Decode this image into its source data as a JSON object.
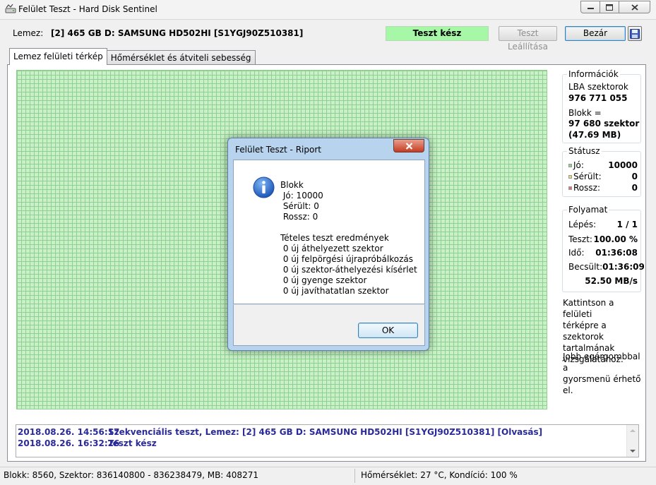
{
  "window": {
    "title": "Felület Teszt - Hard Disk Sentinel"
  },
  "toprow": {
    "disk_label": "Lemez:",
    "disk_value": "[2] 465 GB D: SAMSUNG HD502HI [S1YGJ90Z510381]",
    "status": "Teszt kész",
    "stop_button": "Teszt Leállítása",
    "close_button": "Bezár"
  },
  "tabs": [
    {
      "label": "Lemez felületi térkép",
      "active": true
    },
    {
      "label": "Hőmérséklet és átviteli sebesség",
      "active": false
    }
  ],
  "info": {
    "title": "Információk",
    "lba_label": "LBA szektorok",
    "lba_value": "976 771 055",
    "block_label": "Blokk =",
    "block_sectors": "97 680 szektor",
    "block_size": "(47.69 MB)"
  },
  "status_group": {
    "title": "Státusz",
    "items": [
      {
        "label": "Jó:",
        "value": "10000",
        "color": "#8ed08e"
      },
      {
        "label": "Sérült:",
        "value": "0",
        "color": "#e8d878"
      },
      {
        "label": "Rossz:",
        "value": "0",
        "color": "#e07070"
      }
    ]
  },
  "progress": {
    "title": "Folyamat",
    "step_label": "Lépés:",
    "step_value": "1 / 1",
    "test_label": "Teszt:",
    "test_value": "100.00 %",
    "time_label": "Idő:",
    "time_value": "01:36:08",
    "estimated_label": "Becsült:",
    "estimated_value": "01:36:09",
    "speed": "52.50 MB/s"
  },
  "hints": {
    "click": [
      "Kattintson a felületi",
      "térképre a szektorok",
      "tartalmának",
      "vizsgálatához."
    ],
    "right_click": [
      "Jobb egérgombbal a",
      "gyorsmenü érhető",
      "el."
    ]
  },
  "log": [
    {
      "time": "2018.08.26.  14:56:17",
      "text": "Szekvenciális teszt, Lemez: [2] 465 GB D: SAMSUNG HD502HI [S1YGJ90Z510381] [Olvasás]"
    },
    {
      "time": "2018.08.26.  16:32:26",
      "text": "Teszt kész"
    }
  ],
  "statusbar": {
    "left": "Blokk: 8560, Szektor: 836140800 - 836238479, MB: 408271",
    "right": "Hőmérséklet: 27  °C,  Kondíció: 100 %"
  },
  "dialog": {
    "title": "Felület Teszt - Riport",
    "lines": [
      "Blokk",
      " Jó: 10000",
      " Sérült: 0",
      " Rossz: 0",
      "",
      "Tételes teszt eredmények",
      " 0 új áthelyezett szektor",
      " 0 új felpörgési újrapróbálkozás",
      " 0 új szektor-áthelyezési kísérlet",
      " 0 új gyenge szektor",
      " 0 új javíthatatlan szektor"
    ],
    "ok_button": "OK"
  }
}
